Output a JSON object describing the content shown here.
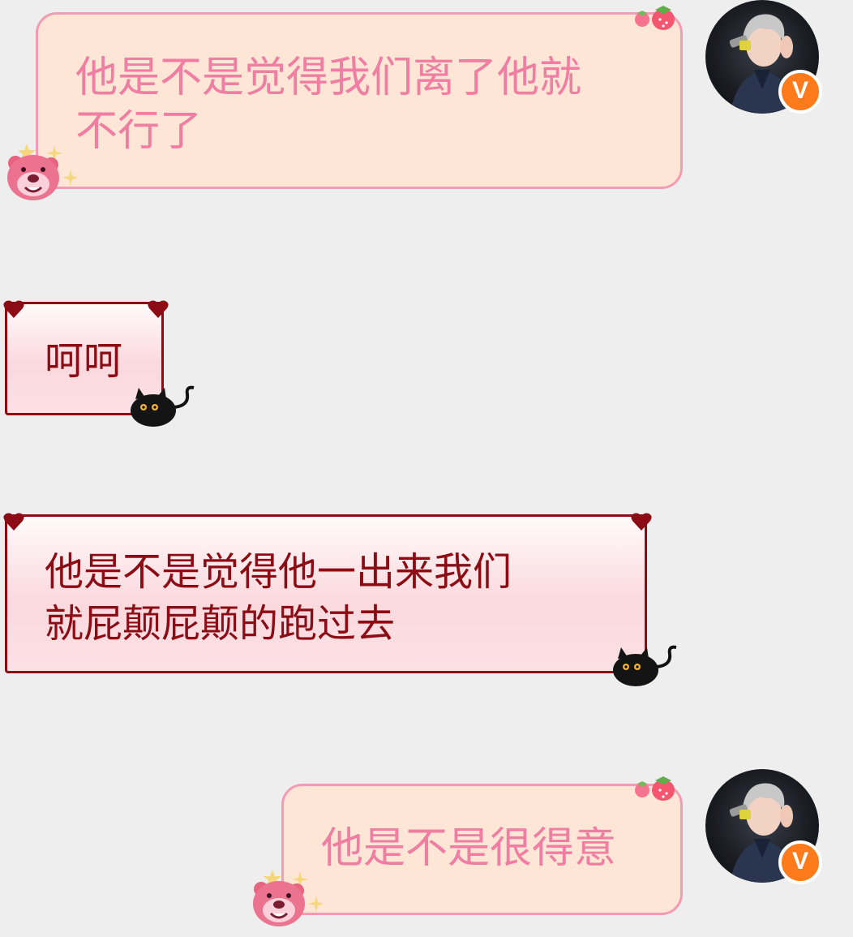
{
  "messages": [
    {
      "side": "right",
      "style": "pink",
      "text": "他是不是觉得我们离了他就\n不行了"
    },
    {
      "side": "left",
      "style": "red",
      "text": "呵呵"
    },
    {
      "side": "left",
      "style": "red",
      "text": "他是不是觉得他一出来我们\n就屁颠屁颠的跑过去"
    },
    {
      "side": "right",
      "style": "pink",
      "text": "他是不是很得意"
    }
  ],
  "avatar": {
    "badge_text": "V"
  },
  "icons": {
    "avatar": "person-avatar-icon",
    "verified": "verified-badge-icon",
    "strawberry": "strawberry-icon",
    "bear": "pink-bear-icon",
    "cat": "black-cat-icon",
    "heart": "heart-icon"
  },
  "colors": {
    "background": "#eeeeee",
    "pink_bubble_fill": "#fde6d6",
    "pink_bubble_border": "#f59ab3",
    "pink_text": "#f07ea3",
    "red_bubble_border": "#8b0c15",
    "red_text": "#8b0c15",
    "badge": "#ff7a1a"
  }
}
